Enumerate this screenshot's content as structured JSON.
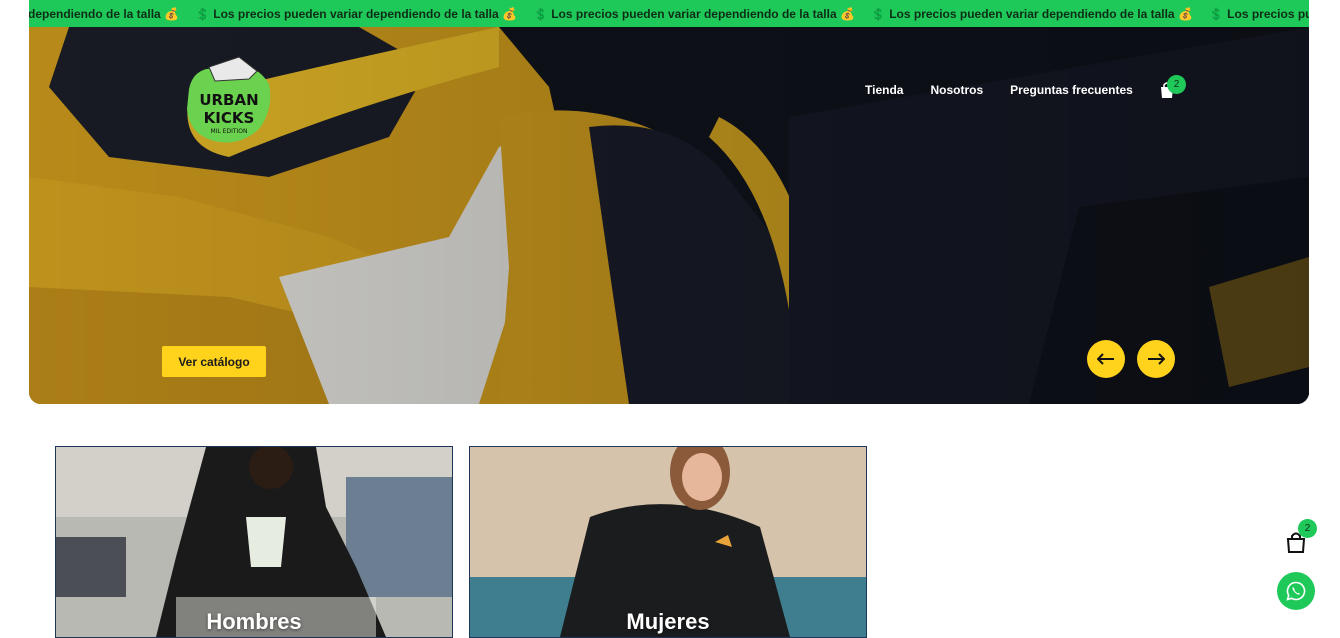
{
  "ticker": {
    "items": [
      "r dependiendo de la talla 💰",
      "💲 Los precios pueden variar dependiendo de la talla 💰",
      "💲 Los precios pueden variar dependiendo de la talla 💰",
      "💲 Los precios pueden variar dependiendo de la talla 💰",
      "💲 Los precios pue"
    ]
  },
  "brand": {
    "logo_line1": "URBAN",
    "logo_line2": "KICKS",
    "logo_sub": "MIL EDITION"
  },
  "nav": {
    "items": [
      "Tienda",
      "Nosotros",
      "Preguntas frecuentes"
    ]
  },
  "cart": {
    "count": "2"
  },
  "hero": {
    "cta_label": "Ver catálogo"
  },
  "categories": [
    {
      "label": "Hombres"
    },
    {
      "label": "Mujeres"
    }
  ],
  "floating_cart": {
    "count": "2"
  },
  "colors": {
    "accent_green": "#1ec95a",
    "accent_yellow": "#ffd21c",
    "card_border": "#1d3557"
  },
  "icons": [
    "bag-icon",
    "arrow-left-icon",
    "arrow-right-icon",
    "whatsapp-icon"
  ]
}
